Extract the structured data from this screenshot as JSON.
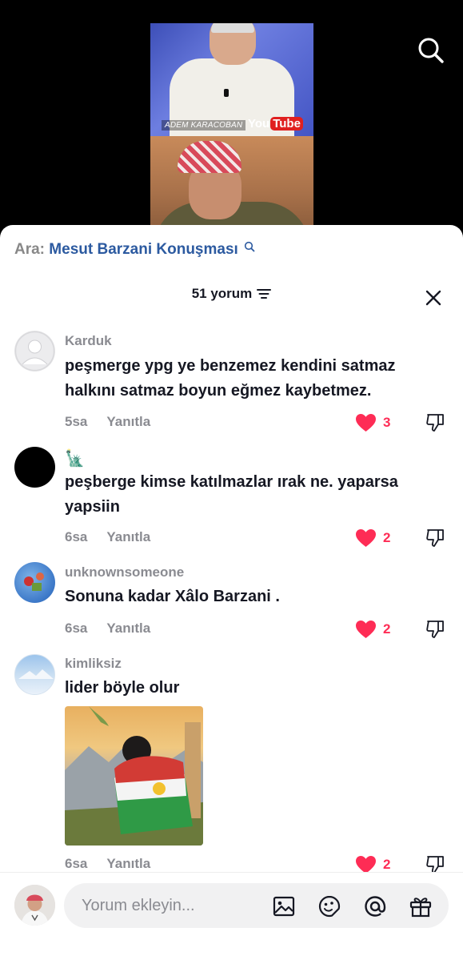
{
  "video": {
    "caption_name": "ADEM KARACOBAN",
    "yt_you": "You",
    "yt_tube": "Tube"
  },
  "search": {
    "prefix": "Ara:",
    "term": "Mesut Barzani Konuşması"
  },
  "header": {
    "count_label": "51 yorum"
  },
  "comments": [
    {
      "username": "Karduk",
      "text": "peşmerge ypg ye benzemez kendini satmaz halkını satmaz boyun eğmez kaybetmez.",
      "time": "5sa",
      "reply": "Yanıtla",
      "likes": "3"
    },
    {
      "username": "🗽",
      "text": "peşberge kimse katılmazlar ırak ne. yaparsa yapsiin",
      "time": "6sa",
      "reply": "Yanıtla",
      "likes": "2"
    },
    {
      "username": "unknownsomeone",
      "text": "Sonuna kadar Xâlo Barzani .",
      "time": "6sa",
      "reply": "Yanıtla",
      "likes": "2"
    },
    {
      "username": "kimliksiz",
      "text": "lider böyle olur",
      "time": "6sa",
      "reply": "Yanıtla",
      "likes": "2"
    }
  ],
  "input": {
    "placeholder": "Yorum ekleyin..."
  },
  "colors": {
    "like": "#fe2c55",
    "link": "#2c5aa0",
    "muted": "#8a8b91"
  },
  "icons": [
    "search-icon",
    "filter-icon",
    "close-icon",
    "heart-icon",
    "dislike-icon",
    "image-icon",
    "emoji-icon",
    "mention-icon",
    "gift-icon"
  ]
}
